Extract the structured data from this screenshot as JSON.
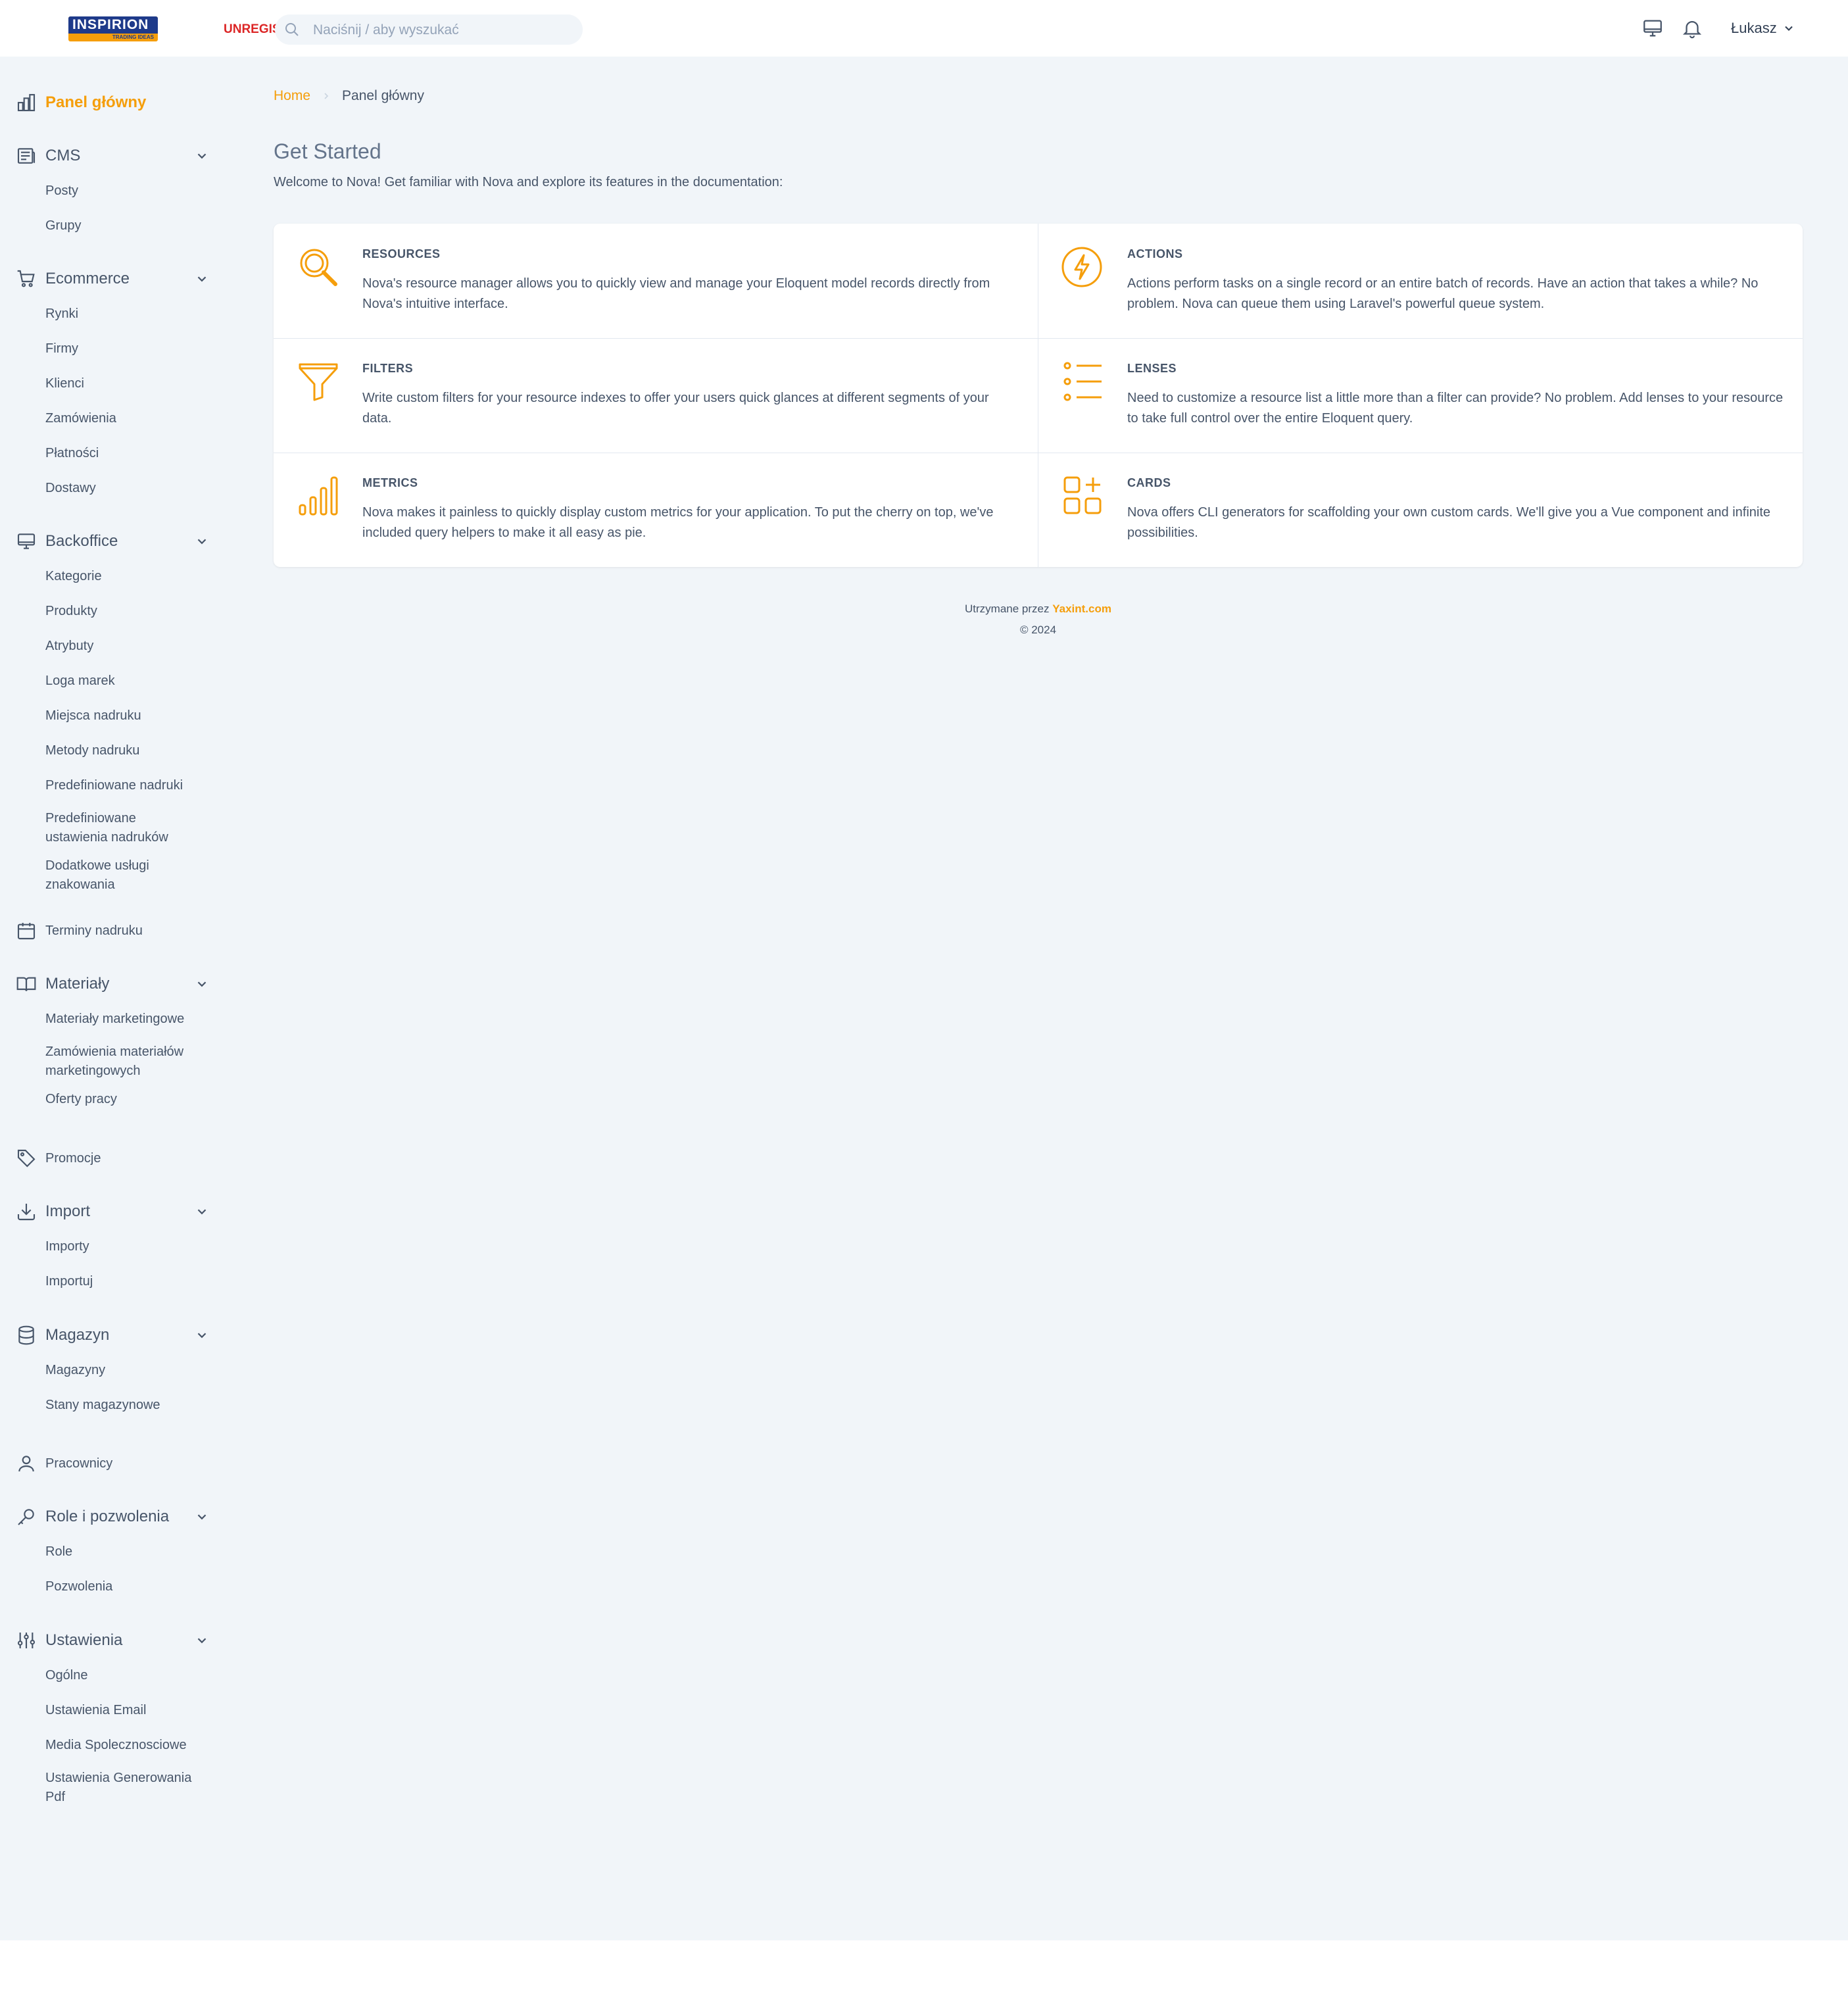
{
  "header": {
    "logo_text": "INSPIRION",
    "logo_sub": "TRADING IDEAS",
    "unregistered": "UNREGIS",
    "search_placeholder": "Naciśnij / aby wyszukać",
    "user_name": "Łukasz"
  },
  "sidebar": {
    "dashboard": "Panel główny",
    "cms": {
      "label": "CMS",
      "items": [
        "Posty",
        "Grupy"
      ]
    },
    "ecommerce": {
      "label": "Ecommerce",
      "items": [
        "Rynki",
        "Firmy",
        "Klienci",
        "Zamówienia",
        "Płatności",
        "Dostawy"
      ]
    },
    "backoffice": {
      "label": "Backoffice",
      "items": [
        "Kategorie",
        "Produkty",
        "Atrybuty",
        "Loga marek",
        "Miejsca nadruku",
        "Metody nadruku",
        "Predefiniowane nadruki",
        "Predefiniowane ustawienia nadruków",
        "Dodatkowe usługi znakowania"
      ]
    },
    "print_terms": "Terminy nadruku",
    "materials": {
      "label": "Materiały",
      "items": [
        "Materiały marketingowe",
        "Zamówienia materiałów marketingowych",
        "Oferty pracy"
      ]
    },
    "promotions": "Promocje",
    "import": {
      "label": "Import",
      "items": [
        "Importy",
        "Importuj"
      ]
    },
    "warehouse": {
      "label": "Magazyn",
      "items": [
        "Magazyny",
        "Stany magazynowe"
      ]
    },
    "employees": "Pracownicy",
    "roles": {
      "label": "Role i pozwolenia",
      "items": [
        "Role",
        "Pozwolenia"
      ]
    },
    "settings": {
      "label": "Ustawienia",
      "items": [
        "Ogólne",
        "Ustawienia Email",
        "Media Spolecznosciowe",
        "Ustawienia Generowania Pdf"
      ]
    }
  },
  "breadcrumb": {
    "home": "Home",
    "current": "Panel główny"
  },
  "main": {
    "title": "Get Started",
    "intro": "Welcome to Nova! Get familiar with Nova and explore its features in the documentation:",
    "cards": [
      {
        "title": "RESOURCES",
        "text": "Nova's resource manager allows you to quickly view and manage your Eloquent model records directly from Nova's intuitive interface.",
        "icon": "search-icon"
      },
      {
        "title": "ACTIONS",
        "text": "Actions perform tasks on a single record or an entire batch of records. Have an action that takes a while? No problem. Nova can queue them using Laravel's powerful queue system.",
        "icon": "lightning-icon"
      },
      {
        "title": "FILTERS",
        "text": "Write custom filters for your resource indexes to offer your users quick glances at different segments of your data.",
        "icon": "funnel-icon"
      },
      {
        "title": "LENSES",
        "text": "Need to customize a resource list a little more than a filter can provide? No problem. Add lenses to your resource to take full control over the entire Eloquent query.",
        "icon": "list-icon"
      },
      {
        "title": "METRICS",
        "text": "Nova makes it painless to quickly display custom metrics for your application. To put the cherry on top, we've included query helpers to make it all easy as pie.",
        "icon": "bar-chart-icon"
      },
      {
        "title": "CARDS",
        "text": "Nova offers CLI generators for scaffolding your own custom cards. We'll give you a Vue component and infinite possibilities.",
        "icon": "cards-icon"
      }
    ]
  },
  "footer": {
    "maintained_by": "Utrzymane przez",
    "link": "Yaxint.com",
    "copyright": "© 2024"
  },
  "colors": {
    "accent": "#f59e0b",
    "background": "#f1f5f9",
    "text": "#475569"
  }
}
